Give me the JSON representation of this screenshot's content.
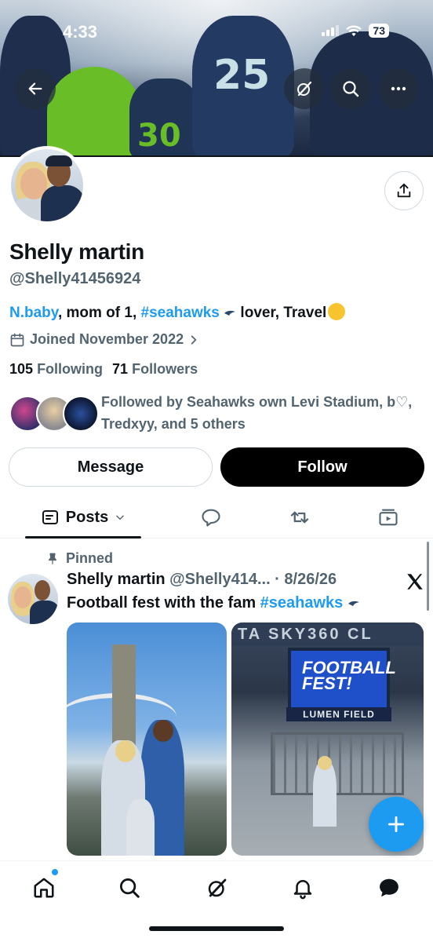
{
  "status_bar": {
    "time": "4:33",
    "battery": "73"
  },
  "banner": {
    "jersey_numbers": [
      "25",
      "30"
    ]
  },
  "profile": {
    "name": "Shelly martin",
    "handle": "@Shelly41456924",
    "bio": {
      "link1": "N.baby",
      "text1": ", mom of 1, ",
      "link2": "#seahawks",
      "text2": " lover, Travel"
    },
    "joined": "Joined November 2022",
    "following_count": "105",
    "following_label": "Following",
    "followers_count": "71",
    "followers_label": "Followers",
    "followed_by": "Followed by Seahawks own Levi Stadium, b♡, Tredxyy, and 5 others"
  },
  "actions": {
    "message_label": "Message",
    "follow_label": "Follow"
  },
  "tabs": {
    "posts_label": "Posts"
  },
  "post": {
    "pinned_label": "Pinned",
    "author_name": "Shelly martin",
    "meta": " @Shelly414... · 8/26/26",
    "text": "Football fest with the fam ",
    "hashtag": "#seahawks",
    "photo2_banner": "TA SKY360 CL",
    "screen_text": "FOOTBALL FEST!",
    "lumen_text": "LUMEN FIELD"
  },
  "icons": {
    "back": "arrow-left-icon",
    "grok": "grok-icon",
    "search": "search-icon",
    "more": "more-icon",
    "share": "share-icon",
    "calendar": "calendar-icon",
    "pin": "pin-icon",
    "x_logo": "x-logo-icon",
    "compose": "plus-icon"
  },
  "colors": {
    "accent": "#1d9bf0",
    "text": "#0f1419",
    "muted": "#536471"
  }
}
